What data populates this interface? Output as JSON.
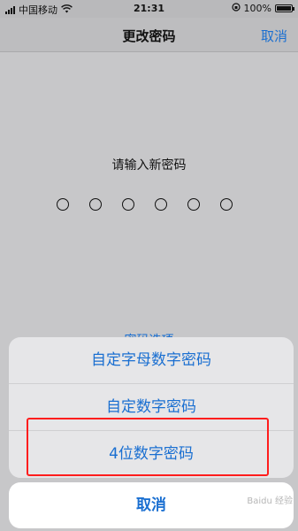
{
  "status_bar": {
    "carrier": "中国移动",
    "time": "21:31",
    "battery": "100%",
    "icons": [
      "signal-icon",
      "wifi-icon",
      "rotation-lock-icon",
      "battery-icon"
    ]
  },
  "nav": {
    "title": "更改密码",
    "cancel": "取消"
  },
  "main": {
    "prompt": "请输入新密码",
    "dot_count": 6,
    "options_link": "密码选项"
  },
  "action_sheet": {
    "items": [
      {
        "label": "自定字母数字密码"
      },
      {
        "label": "自定数字密码"
      },
      {
        "label": "4位数字密码"
      }
    ],
    "cancel": "取消"
  },
  "watermark": "Baidu 经验",
  "colors": {
    "accent": "#1a6fd1",
    "highlight": "#ff1d1d"
  }
}
